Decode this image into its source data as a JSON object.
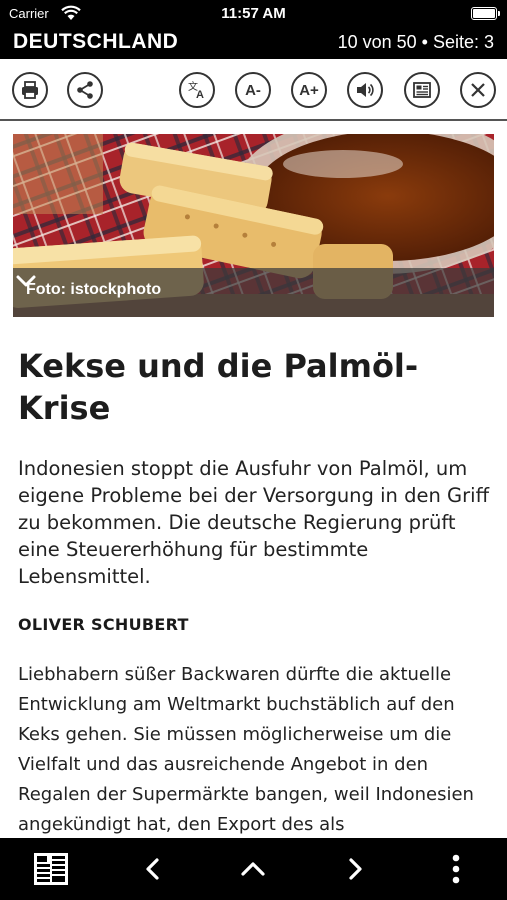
{
  "status": {
    "carrier": "Carrier",
    "time": "11:57 AM"
  },
  "header": {
    "section": "DEUTSCHLAND",
    "page_info": "10 von 50 • Seite: 3"
  },
  "toolbar": {
    "font_smaller": "A-",
    "font_larger": "A+"
  },
  "image": {
    "caption": "Foto: istockphoto"
  },
  "article": {
    "headline": "Kekse und die Palmöl-Krise",
    "lead": "Indonesien stoppt die Ausfuhr von Palmöl, um eigene Probleme bei der Versorgung in den Griff zu bekommen. Die deutsche Regierung prüft eine Steuererhöhung für bestimmte Lebensmittel.",
    "author": "OLIVER SCHUBERT",
    "body": "Liebhabern süßer Backwaren dürfte die aktuelle Entwicklung am Weltmarkt buchstäblich auf den Keks gehen. Sie müssen möglicherweise um die Vielfalt und das ausreichende Angebot in den Regalen der Supermärkte bangen, weil Indonesien angekündigt hat, den Export des als"
  },
  "colors": {
    "bar": "#000000",
    "icon": "#333333",
    "text": "#1a1a1a"
  }
}
